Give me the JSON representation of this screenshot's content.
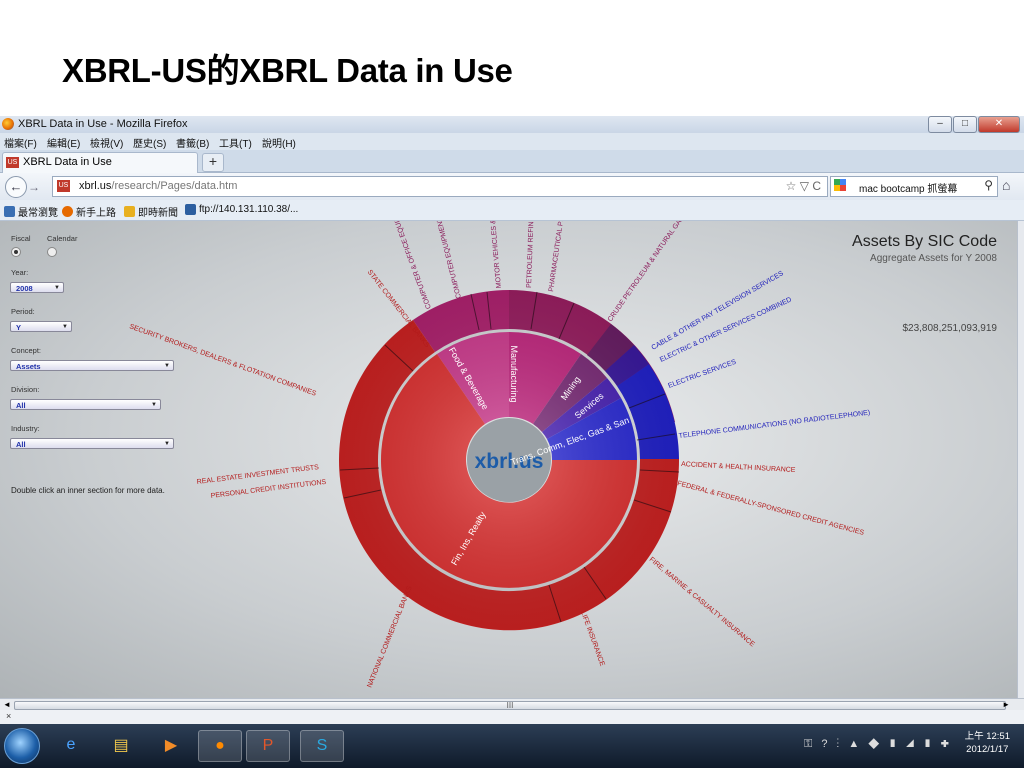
{
  "slide": {
    "title": "XBRL-US的XBRL Data in Use"
  },
  "window": {
    "title": "XBRL Data in Use - Mozilla Firefox",
    "min": "–",
    "max": "□",
    "close": "✕"
  },
  "menu": [
    "檔案(F)",
    "編輯(E)",
    "檢視(V)",
    "歷史(S)",
    "書籤(B)",
    "工具(T)",
    "說明(H)"
  ],
  "tab": {
    "label": "XBRL Data in Use",
    "favicon": "US",
    "new_tab": "+"
  },
  "nav": {
    "url_host": "xbrl.us",
    "url_path": "/research/Pages/data.htm",
    "url_controls": "☆ ▽ C",
    "search_value": "mac bootcamp 抓螢幕",
    "back": "←",
    "forward": "→",
    "home": "⌂",
    "search_go": "⚲"
  },
  "bookmarks": [
    "最常瀏覽",
    "新手上路",
    "即時新聞",
    "ftp://140.131.110.38/..."
  ],
  "panel": {
    "radio_fiscal": "Fiscal",
    "radio_calendar": "Calendar",
    "year_label": "Year:",
    "year_value": "2008",
    "period_label": "Period:",
    "period_value": "Y",
    "concept_label": "Concept:",
    "concept_value": "Assets",
    "division_label": "Division:",
    "division_value": "All",
    "industry_label": "Industry:",
    "industry_value": "All",
    "hint": "Double click an inner section for more data."
  },
  "header": {
    "title": "Assets By SIC Code",
    "subtitle": "Aggregate Assets for Y 2008",
    "total": "$23,808,251,093,919"
  },
  "chart": {
    "center_label": "xbrl.us",
    "inner_labels": [
      "Manufacturing",
      "Food & Beverage",
      "Mining",
      "Services",
      "Trans, Comm, Elec, Gas & San",
      "Fin, Ins, Realty"
    ],
    "outer_labels": [
      "STATE COMMERCIAL BANKS",
      "SECURITY BROKERS, DEALERS & FLOTATION COMPANIES",
      "REAL ESTATE INVESTMENT TRUSTS",
      "PERSONAL CREDIT INSTITUTIONS",
      "NATIONAL COMMERCIAL BANKS",
      "LIFE INSURANCE",
      "FIRE, MARINE & CASUALTY INSURANCE",
      "FEDERAL & FEDERALLY-SPONSORED CREDIT AGENCIES",
      "ACCIDENT & HEALTH INSURANCE",
      "TELEPHONE COMMUNICATIONS (NO RADIOTELEPHONE)",
      "ELECTRIC SERVICES",
      "ELECTRIC & OTHER SERVICES COMBINED",
      "CABLE & OTHER PAY TELEVISION SERVICES",
      "CRUDE PETROLEUM & NATURAL GAS",
      "PHARMACEUTICAL PREPARATIONS",
      "PETROLEUM REFINING",
      "MOTOR VEHICLES & PASSENGER CAR BODIES",
      "COMPUTER EQUIPMENT",
      "COMPUTER & OFFICE EQUIPMENT"
    ]
  },
  "scroll": {
    "left": "◄",
    "right": "►",
    "grip": "III"
  },
  "findbar": {
    "close": "×"
  },
  "taskbar": {
    "clock_time": "上午 12:51",
    "clock_date": "2012/1/17",
    "tray_icons": "⚿ ? ⋮ ▲ ◆ ▮ ◢ ▮ ✚"
  },
  "colors": {
    "finance": "#cc2020",
    "manufacturing": "#b0226e",
    "mining": "#7a1f6e",
    "services": "#4a1fb0",
    "utilities": "#2020c8"
  }
}
